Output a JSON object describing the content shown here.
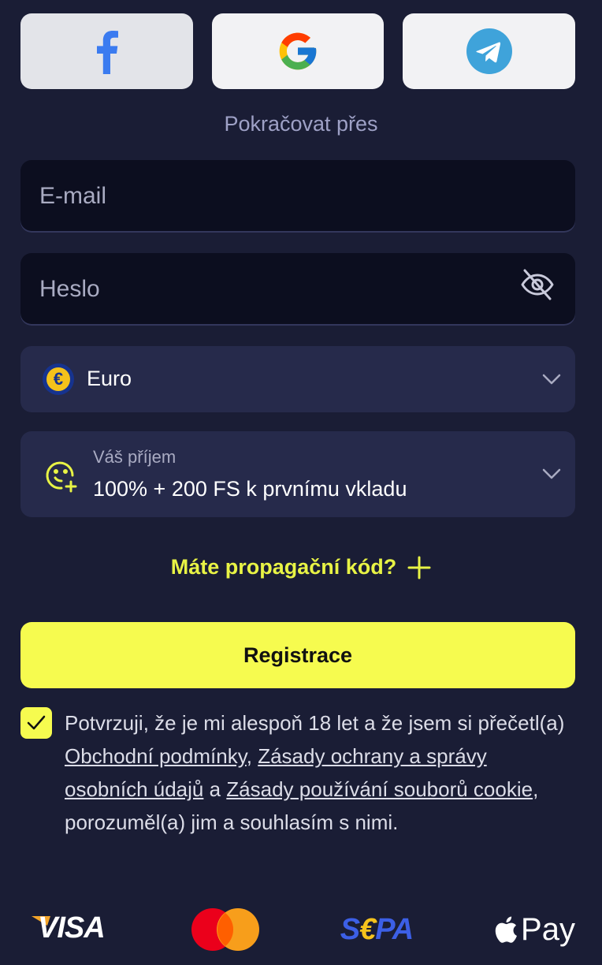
{
  "social": {
    "continue_label": "Pokračovat přes",
    "providers": [
      "facebook-icon",
      "google-icon",
      "telegram-icon"
    ]
  },
  "form": {
    "email_placeholder": "E-mail",
    "password_placeholder": "Heslo",
    "currency_label": "Euro",
    "currency_symbol": "€",
    "bonus_caption": "Váš příjem",
    "bonus_value": "100% + 200 FS k prvnímu vkladu",
    "promo_label": "Máte propagační kód?",
    "register_label": "Registrace"
  },
  "terms": {
    "text_before": "Potvrzuji, že je mi alespoň 18 let a že jsem si přečetl(a) ",
    "link1": "Obchodní podmínky",
    "sep1": ", ",
    "link2": "Zásady ochrany a správy osobních údajů",
    "sep2": " a ",
    "link3": "Zásady používání souborů cookie",
    "text_after": ", porozuměl(a) jim a souhlasím s nimi.",
    "checked": true
  },
  "payments": {
    "visa": "VISA",
    "sepa_s": "S",
    "sepa_e": "€",
    "sepa_pa": "PA",
    "apple_pay": "Pay"
  },
  "colors": {
    "background": "#1a1d35",
    "accent": "#f6fb4f",
    "field": "#0c0e1f",
    "select": "#262a4b"
  }
}
